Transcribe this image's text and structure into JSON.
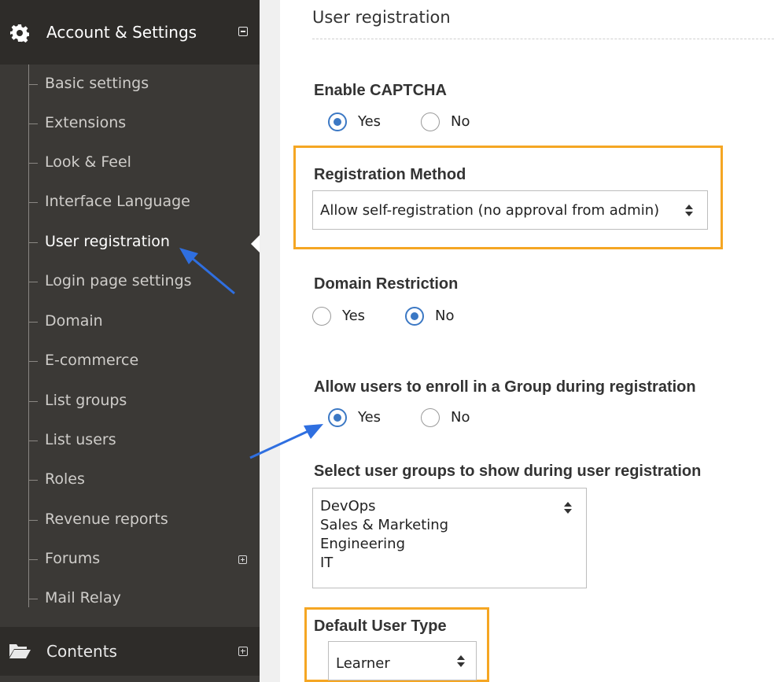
{
  "sidebar": {
    "section_title": "Account & Settings",
    "items": [
      {
        "label": "Basic settings"
      },
      {
        "label": "Extensions"
      },
      {
        "label": "Look & Feel"
      },
      {
        "label": "Interface Language"
      },
      {
        "label": "User registration",
        "active": true
      },
      {
        "label": "Login page settings"
      },
      {
        "label": "Domain"
      },
      {
        "label": "E-commerce"
      },
      {
        "label": "List groups"
      },
      {
        "label": "List users"
      },
      {
        "label": "Roles"
      },
      {
        "label": "Revenue reports"
      },
      {
        "label": "Forums",
        "expandable": true
      },
      {
        "label": "Mail Relay"
      }
    ],
    "footer_title": "Contents",
    "icons": {
      "section": "gear-icon",
      "footer": "folder-icon"
    }
  },
  "main": {
    "page_title": "User registration",
    "captcha": {
      "label": "Enable CAPTCHA",
      "options": [
        "Yes",
        "No"
      ],
      "selected": "Yes"
    },
    "registration_method": {
      "label": "Registration Method",
      "value": "Allow self-registration (no approval from admin)"
    },
    "domain_restriction": {
      "label": "Domain Restriction",
      "options": [
        "Yes",
        "No"
      ],
      "selected": "No"
    },
    "group_enroll": {
      "label": "Allow users to enroll in a Group during registration",
      "options": [
        "Yes",
        "No"
      ],
      "selected": "Yes"
    },
    "user_groups": {
      "label": "Select user groups to show during user registration",
      "options": [
        "DevOps",
        "Sales & Marketing",
        "Engineering",
        "IT"
      ]
    },
    "default_user_type": {
      "label": "Default User Type",
      "value": "Learner"
    }
  },
  "colors": {
    "sidebar_bg": "#3b3936",
    "sidebar_header_bg": "#2e2c29",
    "highlight_border": "#f5a623",
    "radio_accent": "#3b78c4",
    "annotation_arrow": "#2f6fe0"
  }
}
